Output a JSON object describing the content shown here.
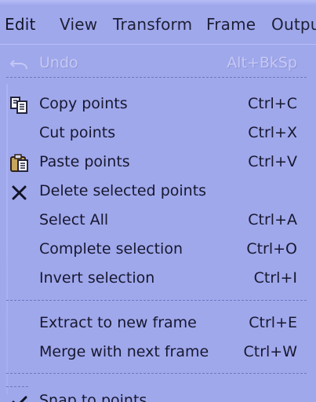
{
  "menubar": {
    "items": [
      {
        "label": "Edit"
      },
      {
        "label": "View"
      },
      {
        "label": "Transform"
      },
      {
        "label": "Frame"
      },
      {
        "label": "Outpu"
      }
    ]
  },
  "menu": {
    "undo": {
      "label": "Undo",
      "shortcut": "Alt+BkSp"
    },
    "copy_points": {
      "label": "Copy points",
      "shortcut": "Ctrl+C"
    },
    "cut_points": {
      "label": "Cut points",
      "shortcut": "Ctrl+X"
    },
    "paste_points": {
      "label": "Paste points",
      "shortcut": "Ctrl+V"
    },
    "delete_selected_points": {
      "label": "Delete selected points"
    },
    "select_all": {
      "label": "Select All",
      "shortcut": "Ctrl+A"
    },
    "complete_selection": {
      "label": "Complete selection",
      "shortcut": "Ctrl+O"
    },
    "invert_selection": {
      "label": "Invert selection",
      "shortcut": "Ctrl+I"
    },
    "extract_to_new_frame": {
      "label": "Extract to new frame",
      "shortcut": "Ctrl+E"
    },
    "merge_with_next_frame": {
      "label": "Merge with next frame",
      "shortcut": "Ctrl+W"
    },
    "snap_to_points": {
      "label": "Snap to points"
    }
  },
  "icons": {
    "undo": "undo-icon",
    "copy": "copy-icon",
    "paste": "paste-icon",
    "delete": "close-icon",
    "snap": "checkmark-icon"
  },
  "colors": {
    "menu_background": "#a0a8ec",
    "text": "#17182f",
    "disabled_text": "#c6c9f4"
  }
}
